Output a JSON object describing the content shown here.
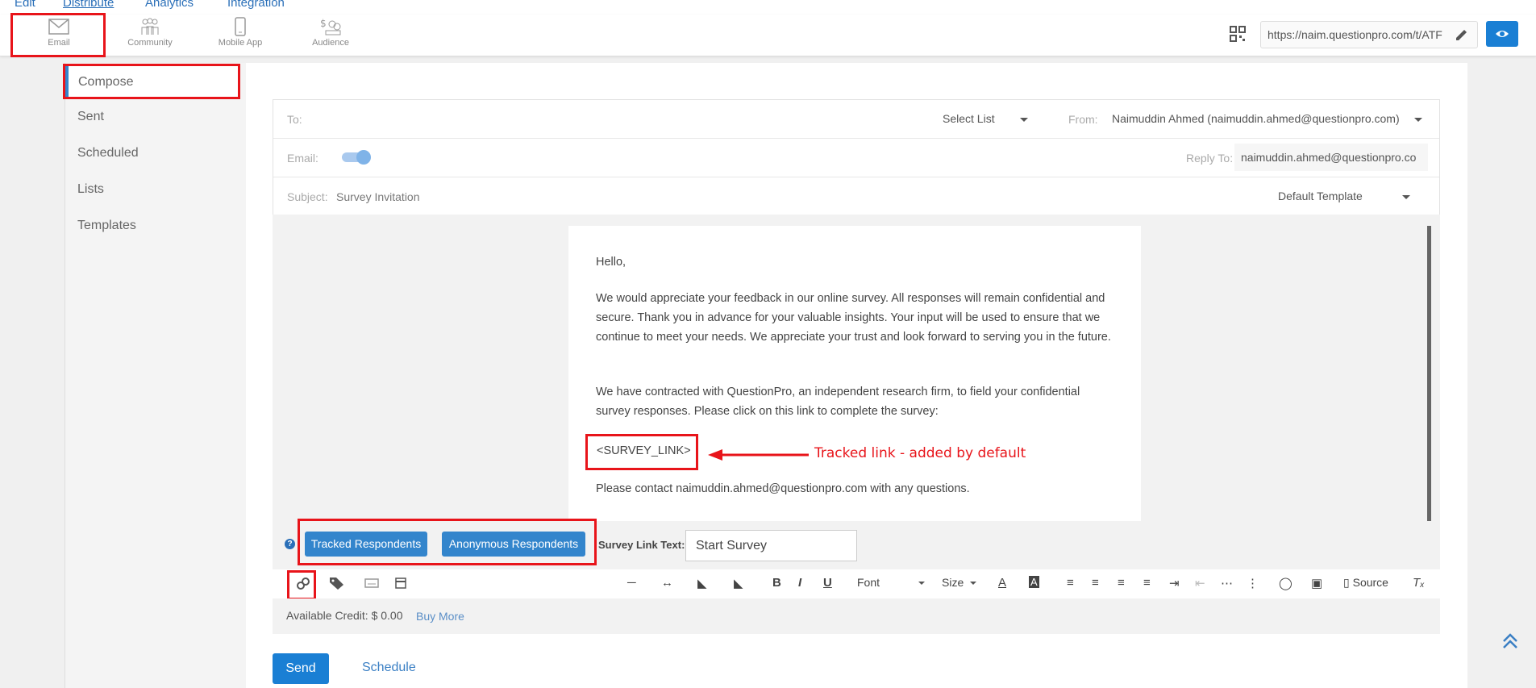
{
  "nav": {
    "edit": "Edit",
    "distribute": "Distribute",
    "analytics": "Analytics",
    "integration": "Integration"
  },
  "toolbar": {
    "email": "Email",
    "community": "Community",
    "mobile_app": "Mobile App",
    "audience": "Audience",
    "survey_url": "https://naim.questionpro.com/t/ATF"
  },
  "sidebar": {
    "items": [
      {
        "label": "Compose"
      },
      {
        "label": "Sent"
      },
      {
        "label": "Scheduled"
      },
      {
        "label": "Lists"
      },
      {
        "label": "Templates"
      }
    ]
  },
  "form": {
    "to_label": "To:",
    "select_list": "Select List",
    "from_label": "From:",
    "from_value": "Naimuddin Ahmed (naimuddin.ahmed@questionpro.com)",
    "email_label": "Email:",
    "reply_to_label": "Reply To:",
    "reply_to_value": "naimuddin.ahmed@questionpro.co",
    "subject_label": "Subject:",
    "subject_value": "Survey Invitation",
    "template_value": "Default Template"
  },
  "email_body": {
    "greeting": "Hello,",
    "para1": "We would appreciate your feedback in our online survey. All responses will remain confidential and secure. Thank you in advance for your valuable insights. Your input will be used to ensure that we continue to meet your needs. We appreciate your trust and look forward to serving you in the future.",
    "para2": "We have contracted with QuestionPro, an independent research firm, to field your confidential survey responses. Please click on this link to complete the survey:",
    "survey_link": "<SURVEY_LINK>",
    "para3": "Please contact naimuddin.ahmed@questionpro.com with any questions."
  },
  "annotation": {
    "text": "Tracked link - added by default"
  },
  "link_controls": {
    "tracked": "Tracked Respondents",
    "anonymous": "Anonymous Respondents",
    "link_text_label": "Survey Link Text:",
    "link_text_value": "Start Survey"
  },
  "editor": {
    "font": "Font",
    "size": "Size",
    "source": "Source"
  },
  "credit": {
    "label": "Available Credit: $ 0.00",
    "buy_more": "Buy More"
  },
  "actions": {
    "send": "Send",
    "schedule": "Schedule"
  },
  "colors": {
    "accent": "#3385cc",
    "highlight": "#e8141a",
    "toggle": "#7fb3e8"
  }
}
